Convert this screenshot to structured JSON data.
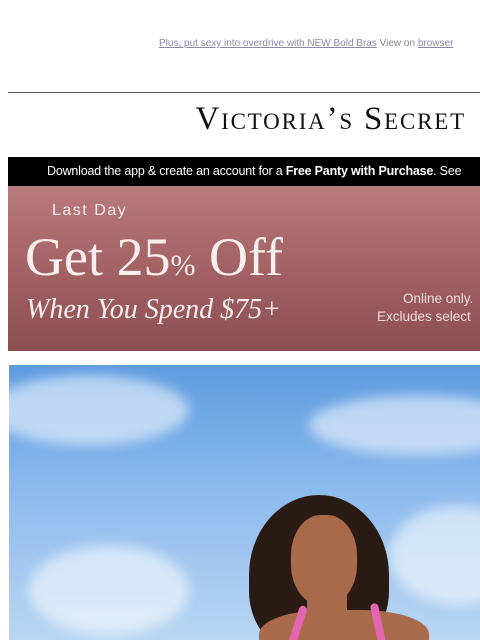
{
  "preheader": {
    "link_text": "Plus, put sexy into overdrive with NEW Bold Bras",
    "view_text": "View on",
    "browser_link": "browser"
  },
  "brand": {
    "logo_text": "Victoria’s Secret"
  },
  "app_bar": {
    "text_prefix": "Download the app & create an account for a ",
    "text_bold": "Free Panty with Purchase",
    "text_suffix": ". See"
  },
  "promo": {
    "tag": "Last Day",
    "headline_number": "Get 25",
    "headline_pct": "%",
    "headline_rest": " Off",
    "subhead": "When You Spend $75+",
    "fine_print_1": "Online only.",
    "fine_print_2": "Excludes select"
  },
  "hero": {
    "image_subject": "model-in-pink-bikini-against-sky"
  },
  "colors": {
    "promo_bg": "#a56466",
    "app_bar_bg": "#000000",
    "sky": "#8cbaee",
    "strap_pink": "#e566b0"
  }
}
